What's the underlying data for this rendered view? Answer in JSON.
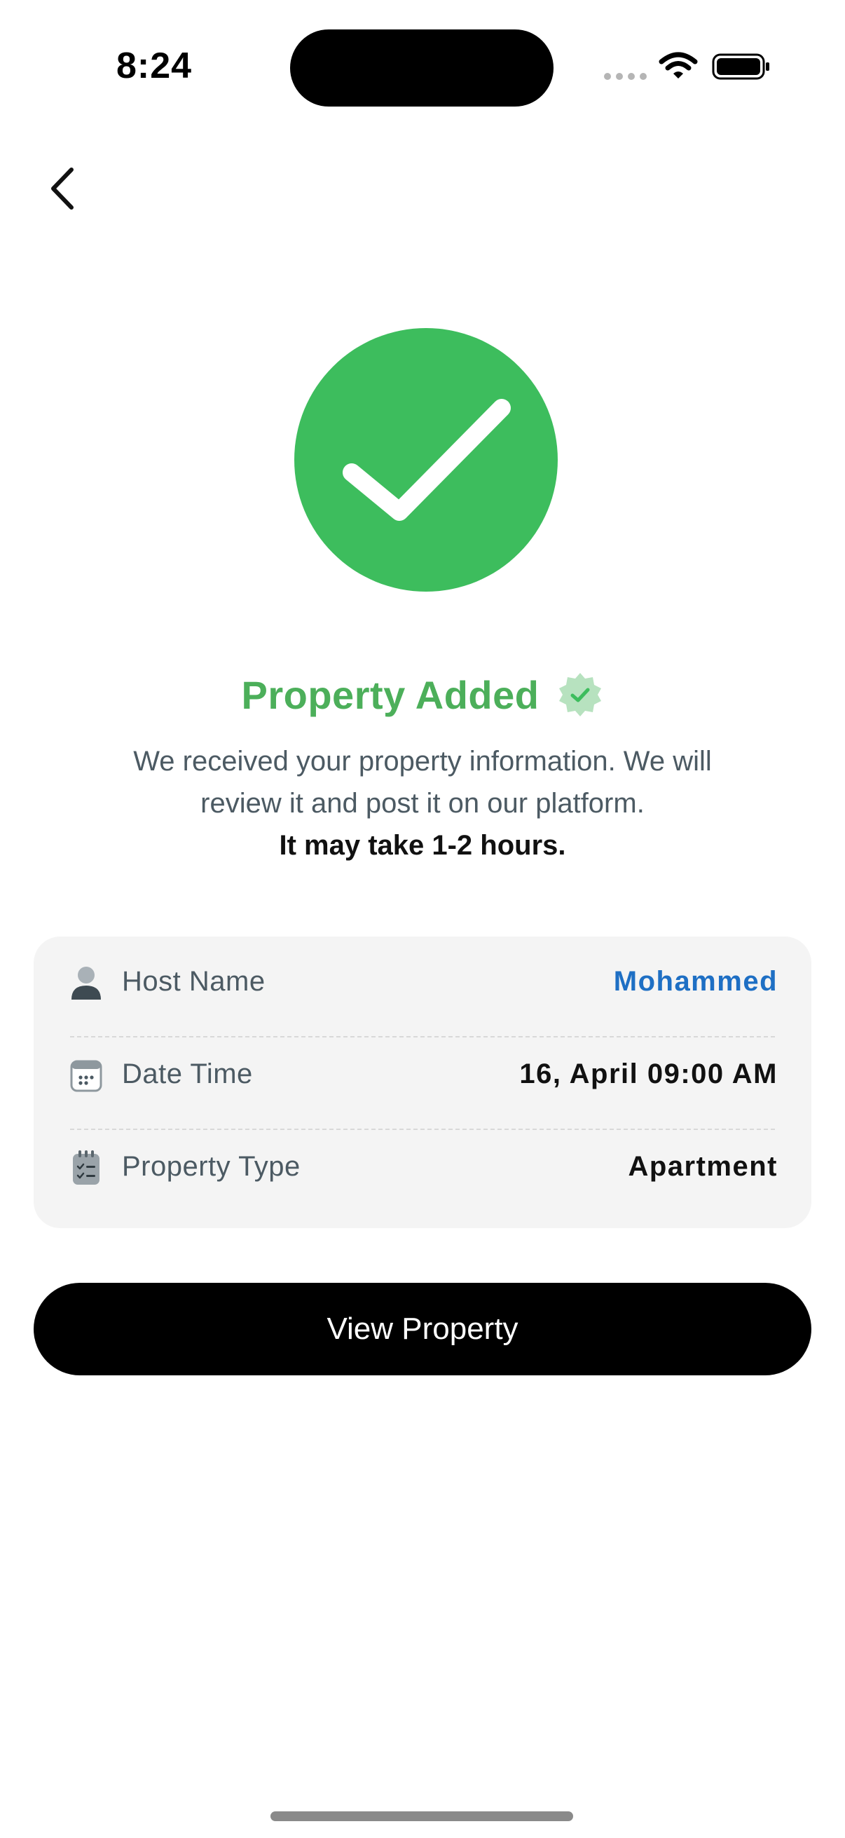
{
  "status_bar": {
    "time": "8:24"
  },
  "nav": {
    "back_icon": "chevron-left-icon"
  },
  "success": {
    "icon": "checkmark-icon",
    "title": "Property Added",
    "badge_icon": "verified-badge-icon",
    "description_line_1": "We received your property information. We will",
    "description_line_2": "review it and post it on our platform.",
    "note": "It may take 1-2 hours."
  },
  "details": [
    {
      "icon": "user-icon",
      "label": "Host Name",
      "value": "Mohammed"
    },
    {
      "icon": "calendar-icon",
      "label": "Date Time",
      "value": "16, April 09:00 AM"
    },
    {
      "icon": "clipboard-list-icon",
      "label": "Property Type",
      "value": "Apartment"
    }
  ],
  "actions": {
    "view_property_label": "View Property"
  },
  "colors": {
    "success_green": "#3dbd5d",
    "title_green": "#4caf5a",
    "accent_blue": "#1e6fc4",
    "card_bg": "#f4f4f4",
    "button_bg": "#000000"
  }
}
